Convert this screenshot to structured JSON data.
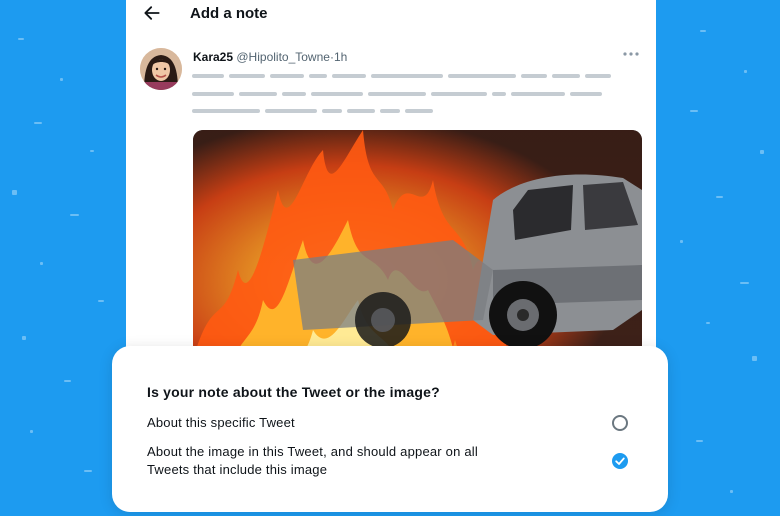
{
  "colors": {
    "background": "#1d9bf0",
    "card": "#ffffff",
    "accent": "#1d9bf0",
    "text_primary": "#0f1419",
    "text_secondary": "#536471",
    "placeholder_line": "#c5ccd2"
  },
  "header": {
    "back_icon": "arrow-left-icon",
    "title": "Add a note"
  },
  "tweet": {
    "author_name": "Kara25",
    "handle": "@Hipolito_Towne",
    "separator": "·",
    "time": "1h",
    "more_icon": "more-horizontal-icon",
    "text_redacted": true,
    "media_description": "burning car"
  },
  "note_question": {
    "question": "Is your note about the Tweet or the image?",
    "options": [
      {
        "label": "About this specific Tweet",
        "selected": false
      },
      {
        "label": "About the image in this Tweet, and should appear on all Tweets that include this image",
        "selected": true
      }
    ]
  }
}
